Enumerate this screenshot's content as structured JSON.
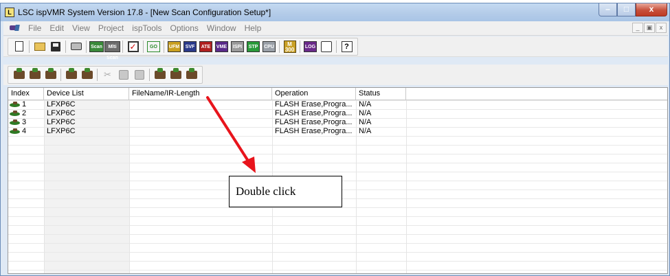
{
  "window": {
    "title": "LSC ispVMR System Version  17.8 - [New Scan Configuration Setup*]",
    "controls": [
      "minimize",
      "maximize",
      "close"
    ]
  },
  "menu": {
    "items": [
      "File",
      "Edit",
      "View",
      "Project",
      "ispTools",
      "Options",
      "Window",
      "Help"
    ]
  },
  "toolbar1": {
    "scan_label": "Scan",
    "multi_scan_label": "Mlti Scan",
    "go_label": "GO",
    "ufm_label": "UFM",
    "svf_label": "SVF",
    "ate_label": "ATE",
    "vme_label": "VME",
    "isp_label": "ISPI",
    "stp_label": "STP",
    "cpu_label": "CPU",
    "m300_label": "M 300",
    "log_label": "LOG",
    "help_label": "?"
  },
  "table": {
    "columns": [
      "Index",
      "Device List",
      "FileName/IR-Length",
      "Operation",
      "Status"
    ],
    "rows": [
      {
        "index": "1",
        "device": "LFXP6C",
        "filename": "",
        "operation": "FLASH Erase,Progra...",
        "status": "N/A"
      },
      {
        "index": "2",
        "device": "LFXP6C",
        "filename": "",
        "operation": "FLASH Erase,Progra...",
        "status": "N/A"
      },
      {
        "index": "3",
        "device": "LFXP6C",
        "filename": "",
        "operation": "FLASH Erase,Progra...",
        "status": "N/A"
      },
      {
        "index": "4",
        "device": "LFXP6C",
        "filename": "",
        "operation": "FLASH Erase,Progra...",
        "status": "N/A"
      }
    ]
  },
  "annotation": {
    "callout_text": "Double click",
    "arrow_color": "#e8141c"
  }
}
